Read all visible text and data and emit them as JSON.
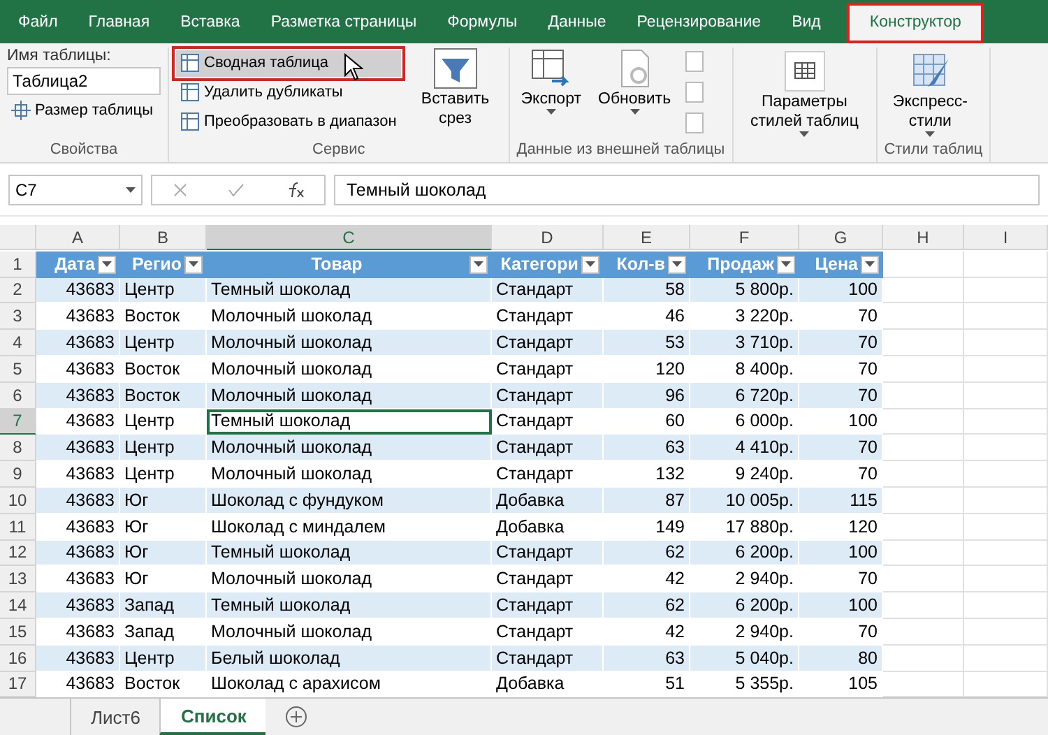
{
  "menu_tabs": [
    {
      "label": "Файл",
      "selected": false,
      "highlighted": false
    },
    {
      "label": "Главная",
      "selected": false,
      "highlighted": false
    },
    {
      "label": "Вставка",
      "selected": false,
      "highlighted": false
    },
    {
      "label": "Разметка страницы",
      "selected": false,
      "highlighted": false
    },
    {
      "label": "Формулы",
      "selected": false,
      "highlighted": false
    },
    {
      "label": "Данные",
      "selected": false,
      "highlighted": false
    },
    {
      "label": "Рецензирование",
      "selected": false,
      "highlighted": false
    },
    {
      "label": "Вид",
      "selected": false,
      "highlighted": false
    },
    {
      "label": "Конструктор",
      "selected": true,
      "highlighted": true
    }
  ],
  "ribbon": {
    "properties": {
      "name_label": "Имя таблицы:",
      "name_value": "Таблица2",
      "resize": "Размер таблицы",
      "group": "Свойства"
    },
    "tools": {
      "commands": [
        {
          "label": "Сводная таблица",
          "highlighted": true
        },
        {
          "label": "Удалить дубликаты",
          "highlighted": false
        },
        {
          "label": "Преобразовать в диапазон",
          "highlighted": false
        }
      ],
      "slicer": "Вставить срез",
      "group": "Сервис"
    },
    "external": {
      "export": "Экспорт",
      "refresh": "Обновить",
      "group": "Данные из внешней таблицы"
    },
    "style_options": {
      "label": "Параметры стилей таблиц"
    },
    "styles": {
      "label": "Экспресс-стили",
      "group": "Стили таблиц"
    }
  },
  "formula_bar": {
    "name_box": "C7",
    "value": "Темный шоколад"
  },
  "columns": [
    {
      "label": "A",
      "selected": false
    },
    {
      "label": "B",
      "selected": false
    },
    {
      "label": "C",
      "selected": true
    },
    {
      "label": "D",
      "selected": false
    },
    {
      "label": "E",
      "selected": false
    },
    {
      "label": "F",
      "selected": false
    },
    {
      "label": "G",
      "selected": false
    },
    {
      "label": "H",
      "selected": false
    },
    {
      "label": "I",
      "selected": false
    }
  ],
  "table_header": {
    "row": "1",
    "cells": [
      "Дата",
      "Регио",
      "Товар",
      "Категори",
      "Кол-в",
      "Продаж",
      "Цена"
    ]
  },
  "rows": [
    {
      "num": "2",
      "selected": false,
      "cells": [
        "43683",
        "Центр",
        "Темный шоколад",
        "Стандарт",
        "58",
        "5 800р.",
        "100"
      ]
    },
    {
      "num": "3",
      "selected": false,
      "cells": [
        "43683",
        "Восток",
        "Молочный шоколад",
        "Стандарт",
        "46",
        "3 220р.",
        "70"
      ]
    },
    {
      "num": "4",
      "selected": false,
      "cells": [
        "43683",
        "Центр",
        "Молочный шоколад",
        "Стандарт",
        "53",
        "3 710р.",
        "70"
      ]
    },
    {
      "num": "5",
      "selected": false,
      "cells": [
        "43683",
        "Восток",
        "Молочный шоколад",
        "Стандарт",
        "120",
        "8 400р.",
        "70"
      ]
    },
    {
      "num": "6",
      "selected": false,
      "cells": [
        "43683",
        "Восток",
        "Молочный шоколад",
        "Стандарт",
        "96",
        "6 720р.",
        "70"
      ]
    },
    {
      "num": "7",
      "selected": true,
      "cells": [
        "43683",
        "Центр",
        "Темный шоколад",
        "Стандарт",
        "60",
        "6 000р.",
        "100"
      ]
    },
    {
      "num": "8",
      "selected": false,
      "cells": [
        "43683",
        "Центр",
        "Молочный шоколад",
        "Стандарт",
        "63",
        "4 410р.",
        "70"
      ]
    },
    {
      "num": "9",
      "selected": false,
      "cells": [
        "43683",
        "Центр",
        "Молочный шоколад",
        "Стандарт",
        "132",
        "9 240р.",
        "70"
      ]
    },
    {
      "num": "10",
      "selected": false,
      "cells": [
        "43683",
        "Юг",
        "Шоколад с фундуком",
        "Добавка",
        "87",
        "10 005р.",
        "115"
      ]
    },
    {
      "num": "11",
      "selected": false,
      "cells": [
        "43683",
        "Юг",
        "Шоколад с миндалем",
        "Добавка",
        "149",
        "17 880р.",
        "120"
      ]
    },
    {
      "num": "12",
      "selected": false,
      "cells": [
        "43683",
        "Юг",
        "Темный шоколад",
        "Стандарт",
        "62",
        "6 200р.",
        "100"
      ]
    },
    {
      "num": "13",
      "selected": false,
      "cells": [
        "43683",
        "Юг",
        "Молочный шоколад",
        "Стандарт",
        "42",
        "2 940р.",
        "70"
      ]
    },
    {
      "num": "14",
      "selected": false,
      "cells": [
        "43683",
        "Запад",
        "Темный шоколад",
        "Стандарт",
        "62",
        "6 200р.",
        "100"
      ]
    },
    {
      "num": "15",
      "selected": false,
      "cells": [
        "43683",
        "Запад",
        "Молочный шоколад",
        "Стандарт",
        "42",
        "2 940р.",
        "70"
      ]
    },
    {
      "num": "16",
      "selected": false,
      "cells": [
        "43683",
        "Центр",
        "Белый шоколад",
        "Стандарт",
        "63",
        "5 040р.",
        "80"
      ]
    },
    {
      "num": "17",
      "selected": false,
      "cells": [
        "43683",
        "Восток",
        "Шоколад с арахисом",
        "Добавка",
        "51",
        "5 355р.",
        "105"
      ]
    }
  ],
  "sheet_tabs": [
    {
      "label": "Лист6",
      "selected": false
    },
    {
      "label": "Список",
      "selected": true
    }
  ]
}
